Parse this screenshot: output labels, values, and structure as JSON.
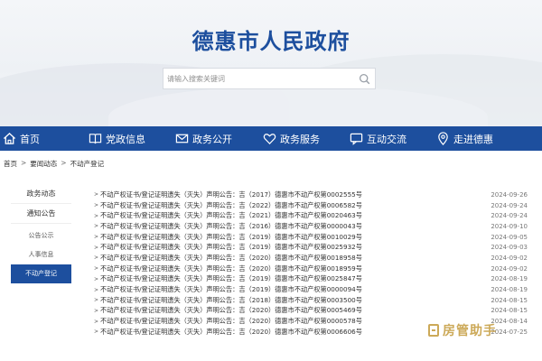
{
  "header": {
    "site_title": "德惠市人民政府",
    "search_placeholder": "请输入搜索关键词"
  },
  "nav": {
    "items": [
      {
        "label": "首页",
        "icon": "home-icon"
      },
      {
        "label": "党政信息",
        "icon": "book-icon"
      },
      {
        "label": "政务公开",
        "icon": "mail-icon"
      },
      {
        "label": "政务服务",
        "icon": "heart-icon"
      },
      {
        "label": "互动交流",
        "icon": "chat-icon"
      },
      {
        "label": "走进德惠",
        "icon": "location-icon"
      }
    ]
  },
  "breadcrumb": {
    "items": [
      "首页",
      "要闻动态",
      "不动产登记"
    ],
    "separator": ">"
  },
  "sidebar": {
    "items": [
      "政务动态",
      "通知公告"
    ],
    "subitems": [
      "公告公示",
      "人事信息",
      "不动产登记"
    ]
  },
  "list": {
    "rows": [
      {
        "title": "不动产权证书/登记证明遗失（灭失）声明公告：吉（2017）德惠市不动产权第0002555号",
        "date": "2024-09-26"
      },
      {
        "title": "不动产权证书/登记证明遗失（灭失）声明公告：吉（2022）德惠市不动产权第0006582号",
        "date": "2024-09-24"
      },
      {
        "title": "不动产权证书/登记证明遗失（灭失）声明公告：吉（2021）德惠市不动产权第0020463号",
        "date": "2024-09-24"
      },
      {
        "title": "不动产权证书/登记证明遗失（灭失）声明公告：吉（2016）德惠市不动产权第0000043号",
        "date": "2024-09-10"
      },
      {
        "title": "不动产权证书/登记证明遗失（灭失）声明公告：吉（2019）德惠市不动产权第0010029号",
        "date": "2024-09-05"
      },
      {
        "title": "不动产权证书/登记证明遗失（灭失）声明公告：吉（2019）德惠市不动产权第0025932号",
        "date": "2024-09-03"
      },
      {
        "title": "不动产权证书/登记证明遗失（灭失）声明公告：吉（2020）德惠市不动产权第0018958号",
        "date": "2024-09-02"
      },
      {
        "title": "不动产权证书/登记证明遗失（灭失）声明公告：吉（2020）德惠市不动产权第0018959号",
        "date": "2024-09-02"
      },
      {
        "title": "不动产权证书/登记证明遗失（灭失）声明公告：吉（2019）德惠市不动产权第0025847号",
        "date": "2024-08-19"
      },
      {
        "title": "不动产权证书/登记证明遗失（灭失）声明公告：吉（2019）德惠市不动产权第0000094号",
        "date": "2024-08-19"
      },
      {
        "title": "不动产权证书/登记证明遗失（灭失）声明公告：吉（2018）德惠市不动产权第0003500号",
        "date": "2024-08-15"
      },
      {
        "title": "不动产权证书/登记证明遗失（灭失）声明公告：吉（2020）德惠市不动产权第0005469号",
        "date": "2024-08-15"
      },
      {
        "title": "不动产权证书/登记证明遗失（灭失）声明公告：吉（2020）德惠市不动产权第0000578号",
        "date": "2024-08-14"
      },
      {
        "title": "不动产权证书/登记证明遗失（灭失）声明公告：吉（2020）德惠市不动产权第0006606号",
        "date": "2024-07-25"
      }
    ]
  },
  "watermark": {
    "text": "房管助手"
  },
  "colors": {
    "brand": "#1d4f9e",
    "watermark": "#c8a24a"
  }
}
